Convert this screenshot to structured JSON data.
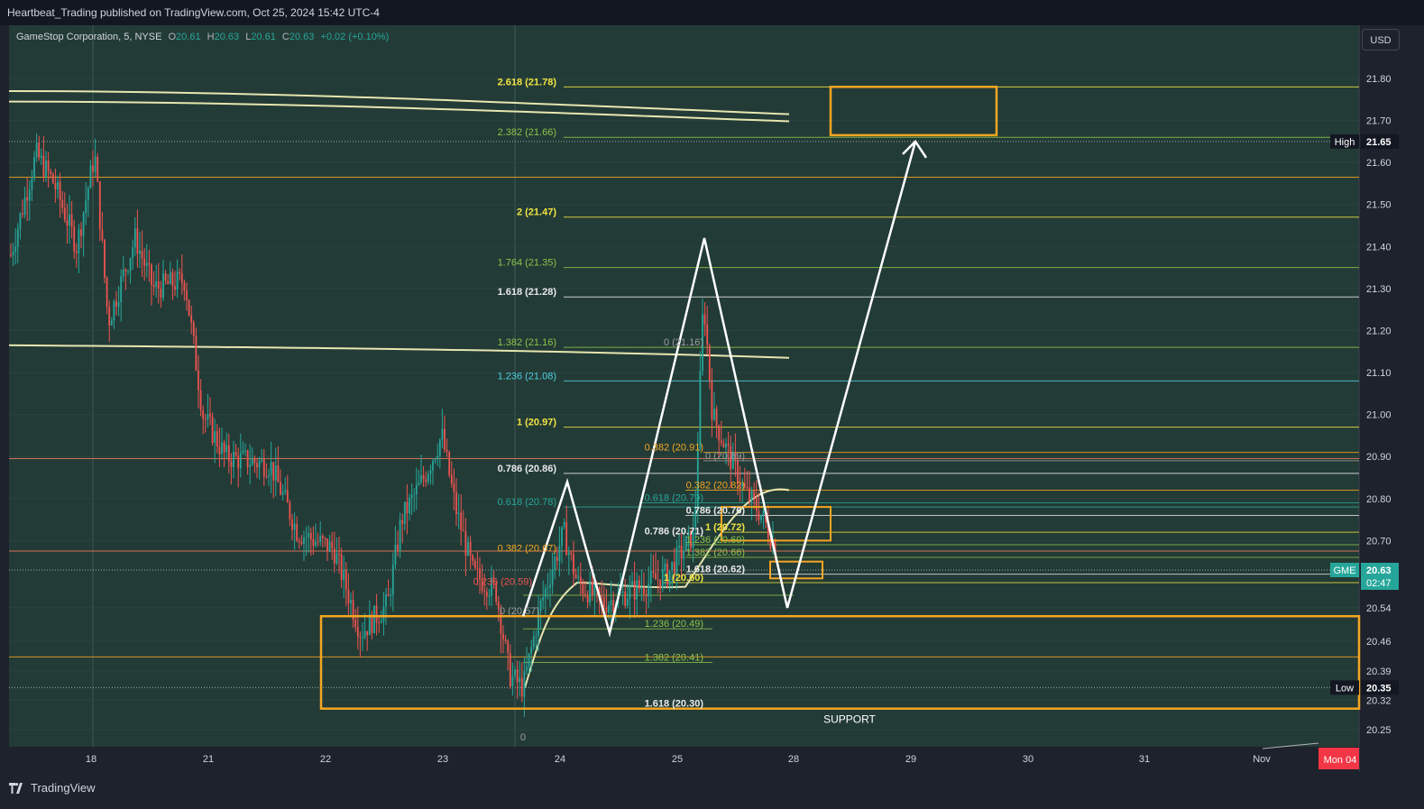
{
  "header": {
    "publisher_line": "Heartbeat_Trading published on TradingView.com, Oct 25, 2024 15:42 UTC-4"
  },
  "legend": {
    "symbol": "GameStop Corporation, 5, NYSE",
    "o_label": "O",
    "o": "20.61",
    "h_label": "H",
    "h": "20.63",
    "l_label": "L",
    "l": "20.61",
    "c_label": "C",
    "c": "20.63",
    "change": "+0.02 (+0.10%)"
  },
  "currency_button": "USD",
  "footer": {
    "brand": "TradingView"
  },
  "colors": {
    "background": "#1e222d",
    "plot_bg": "#233b36",
    "up": "#26a69a",
    "down": "#ef5350",
    "orange": "#f5a623",
    "yellow": "#f0e442"
  },
  "chart_data": {
    "type": "candlestick",
    "symbol": "GME",
    "timeframe": "5",
    "y_range": [
      20.2,
      21.9
    ],
    "y_ticks": [
      "21.80",
      "21.70",
      "21.60",
      "21.50",
      "21.40",
      "21.30",
      "21.20",
      "21.10",
      "21.00",
      "20.90",
      "20.80",
      "20.70",
      "20.54",
      "20.46",
      "20.39",
      "20.32",
      "20.25"
    ],
    "x_ticks": [
      "18",
      "21",
      "22",
      "23",
      "24",
      "25",
      "28",
      "29",
      "30",
      "31",
      "Nov"
    ],
    "price_tags": [
      {
        "label": "High",
        "value": "21.65",
        "price": 21.65
      },
      {
        "label": "GME",
        "value": "20.63",
        "sub": "02:47",
        "price": 20.63
      },
      {
        "label": "Low",
        "value": "20.35",
        "price": 20.35
      }
    ],
    "date_tag": "Mon 04",
    "fib_labels": [
      {
        "text": "2.618 (21.78)",
        "price": 21.78,
        "color": "yellow"
      },
      {
        "text": "2.382 (21.66)",
        "price": 21.66,
        "color": "green"
      },
      {
        "text": "2 (21.47)",
        "price": 21.47,
        "color": "yellow"
      },
      {
        "text": "1.764 (21.35)",
        "price": 21.35,
        "color": "green"
      },
      {
        "text": "1.618 (21.28)",
        "price": 21.28,
        "color": "white"
      },
      {
        "text": "1.382 (21.16)",
        "price": 21.16,
        "color": "green"
      },
      {
        "text": "1.236 (21.08)",
        "price": 21.08,
        "color": "cyan"
      },
      {
        "text": "1 (20.97)",
        "price": 20.97,
        "color": "yellow"
      },
      {
        "text": "0.786 (20.86)",
        "price": 20.86,
        "color": "white"
      },
      {
        "text": "0.618 (20.78)",
        "price": 20.78,
        "color": "teal"
      },
      {
        "text": "0.382 (20.67)",
        "price": 20.67,
        "color": "orange"
      },
      {
        "text": "0.236 (20.59)",
        "price": 20.59,
        "color": "red"
      },
      {
        "text": "0 (21.16)",
        "price": 21.16,
        "color": "gray"
      },
      {
        "text": "0.382 (20.91)",
        "price": 20.91,
        "color": "orange"
      },
      {
        "text": "0 (20.89)",
        "price": 20.89,
        "color": "gray"
      },
      {
        "text": "0.382 (20.82)",
        "price": 20.82,
        "color": "orange"
      },
      {
        "text": "0.618 (20.79)",
        "price": 20.79,
        "color": "teal"
      },
      {
        "text": "0.786 (20.76)",
        "price": 20.76,
        "color": "white"
      },
      {
        "text": "0.786 (20.71)",
        "price": 20.71,
        "color": "white"
      },
      {
        "text": "1 (20.72)",
        "price": 20.72,
        "color": "yellow"
      },
      {
        "text": "1.236 (20.69)",
        "price": 20.69,
        "color": "green"
      },
      {
        "text": "1.382 (20.66)",
        "price": 20.66,
        "color": "green"
      },
      {
        "text": "1.618 (20.62)",
        "price": 20.62,
        "color": "white"
      },
      {
        "text": "1 (20.60)",
        "price": 20.6,
        "color": "yellow"
      },
      {
        "text": "1.236 (20.49)",
        "price": 20.49,
        "color": "green"
      },
      {
        "text": "1.382 (20.41)",
        "price": 20.41,
        "color": "green"
      },
      {
        "text": "1.618 (20.30)",
        "price": 20.3,
        "color": "white"
      },
      {
        "text": "0 (20.57)",
        "price": 20.52,
        "color": "gray"
      },
      {
        "text": "0",
        "price": 20.22,
        "color": "gray"
      }
    ],
    "annotations": [
      {
        "text": "SUPPORT"
      }
    ],
    "grid": true,
    "legend_position": "top-left"
  }
}
